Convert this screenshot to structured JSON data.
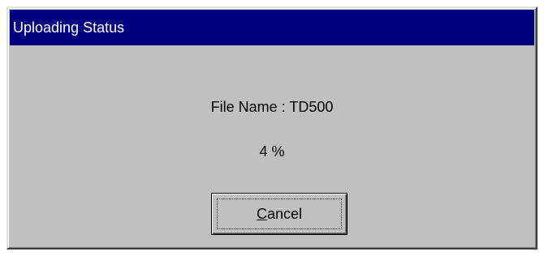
{
  "window": {
    "title": "Uploading Status"
  },
  "status": {
    "file_name_text": "File Name : TD500",
    "percent_text": "4 %",
    "progress_percent": 4
  },
  "buttons": {
    "cancel_mnemonic": "C",
    "cancel_rest": "ancel"
  },
  "colors": {
    "titlebar": "#000080",
    "face": "#c0c0c0",
    "title_text": "#ffffff"
  }
}
